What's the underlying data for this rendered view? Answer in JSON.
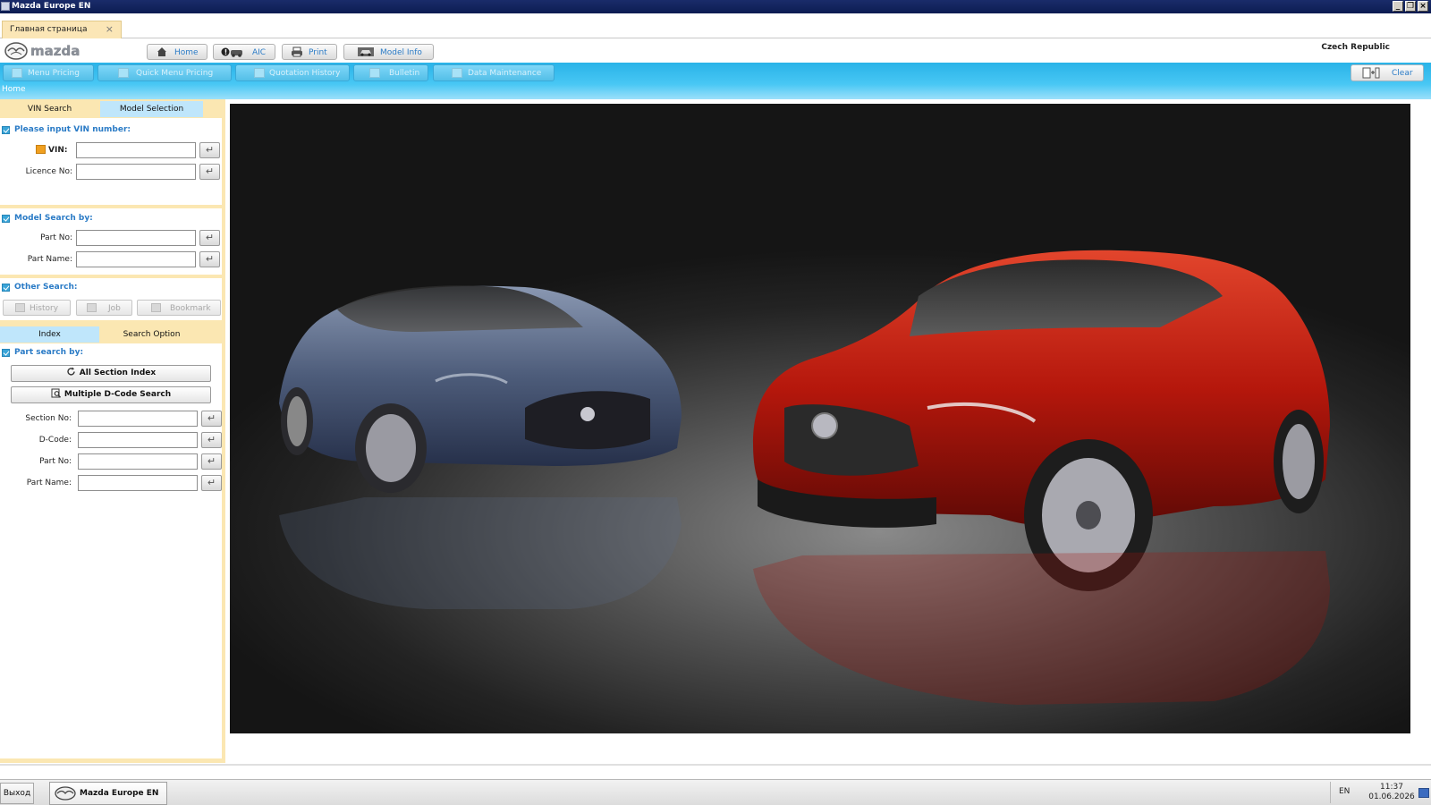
{
  "window": {
    "title": "Mazda Europe EN"
  },
  "doc_tab": {
    "label": "Главная страница",
    "close": "×"
  },
  "header": {
    "nav": [
      {
        "label": "Home",
        "icon": "home-icon"
      },
      {
        "label": "AIC",
        "icon": "aic-icon"
      },
      {
        "label": "Print",
        "icon": "printer-icon"
      },
      {
        "label": "Model Info",
        "icon": "car-icon"
      }
    ],
    "country": "Czech Republic"
  },
  "toolbar": {
    "items": [
      {
        "label": "Menu Pricing",
        "icon": "menu-pricing-icon"
      },
      {
        "label": "Quick Menu Pricing",
        "icon": "quick-menu-pricing-icon"
      },
      {
        "label": "Quotation History",
        "icon": "quotation-history-icon"
      },
      {
        "label": "Bulletin",
        "icon": "bulletin-icon"
      },
      {
        "label": "Data Maintenance",
        "icon": "data-maintenance-icon"
      }
    ],
    "clear_label": "Clear"
  },
  "breadcrumb": "Home",
  "left": {
    "tabs": [
      "VIN Search",
      "Model Selection"
    ],
    "vin_section": {
      "title": "Please input VIN number:",
      "vin_label": "VIN:",
      "vin_value": "",
      "licence_label": "Licence No:",
      "licence_value": ""
    },
    "model_section": {
      "title": "Model Search by:",
      "part_no_label": "Part No:",
      "part_name_label": "Part Name:"
    },
    "other_section": {
      "title": "Other Search:",
      "buttons": [
        "History",
        "Job",
        "Bookmark"
      ]
    },
    "tabs2": [
      "Index",
      "Search Option"
    ],
    "part_section": {
      "title": "Part search by:",
      "all_section_index": "All Section Index",
      "multiple_dcode": "Multiple D-Code Search",
      "section_no_label": "Section No:",
      "dcode_label": "D-Code:",
      "part_no_label": "Part No:",
      "part_name_label": "Part Name:"
    }
  },
  "colors": {
    "title_bar": "#0c1c52",
    "toolbar_blue": "#29b3e8",
    "panel_bg": "#fbe7b2",
    "link_blue": "#2a7bc6",
    "car_left": "#4a5a78",
    "car_right": "#c01a0e"
  },
  "taskbar": {
    "exit_label": "Выход",
    "task_label": "Mazda Europe EN",
    "lang": "EN",
    "time": "11:37",
    "date": "01.06.2026"
  }
}
